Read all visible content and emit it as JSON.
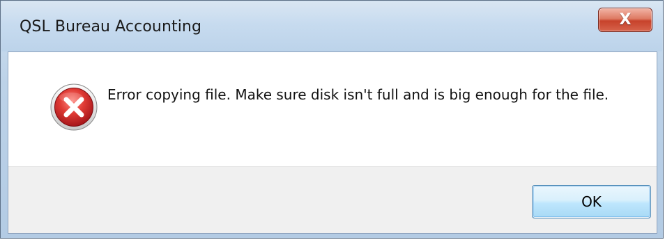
{
  "window": {
    "title": "QSL Bureau Accounting",
    "close_label": "X"
  },
  "dialog": {
    "icon": "error-icon",
    "message": "Error copying file.  Make sure disk isn't full and is big enough for the file.",
    "ok_label": "OK"
  },
  "colors": {
    "close_button": "#c7422b",
    "error_icon": "#c9242a",
    "ok_button_border": "#3c7fb1"
  }
}
